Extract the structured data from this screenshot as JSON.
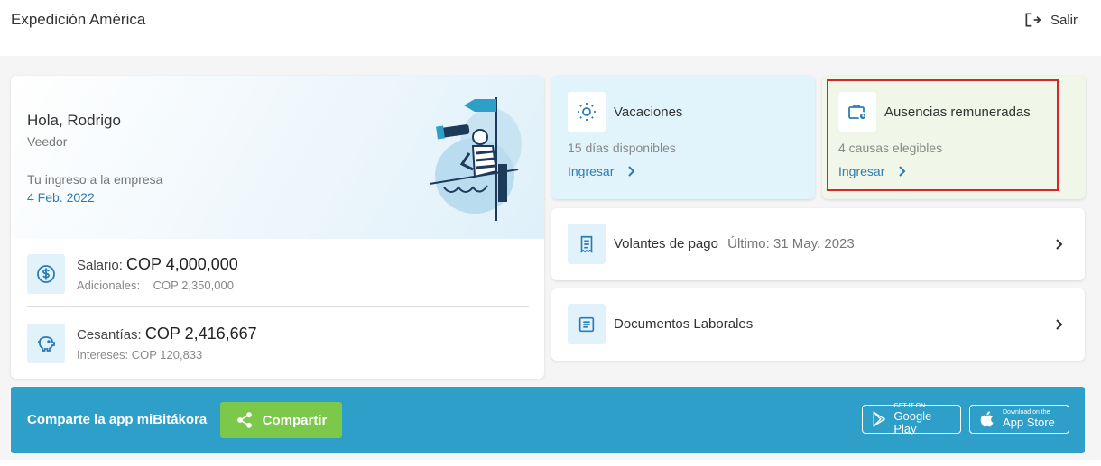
{
  "header": {
    "title": "Expedición América",
    "logout_label": "Salir"
  },
  "profile": {
    "greeting": "Hola, Rodrigo",
    "role": "Veedor",
    "join_label": "Tu ingreso a la empresa",
    "join_date": "4 Feb. 2022",
    "salary": {
      "label": "Salario:",
      "amount": "COP 4,000,000",
      "extra_label": "Adicionales:",
      "extra_value": "COP 2,350,000"
    },
    "cesantias": {
      "label": "Cesantías:",
      "amount": "COP 2,416,667",
      "extra_label": "Intereses:",
      "extra_value": "COP 120,833"
    }
  },
  "vacaciones": {
    "title": "Vacaciones",
    "subtitle": "15 días disponibles",
    "link": "Ingresar"
  },
  "ausencias": {
    "title": "Ausencias remuneradas",
    "subtitle": "4 causas elegibles",
    "link": "Ingresar"
  },
  "volantes": {
    "title": "Volantes de pago",
    "detail": "Último: 31 May. 2023"
  },
  "documentos": {
    "title": "Documentos Laborales"
  },
  "share": {
    "text": "Comparte la app miBitákora",
    "button": "Compartir",
    "google_small": "GET IT ON",
    "google_big": "Google Play",
    "apple_small": "Download on the",
    "apple_big": "App Store"
  },
  "colors": {
    "accent": "#2a7cb5",
    "banner": "#2e9fc8",
    "share_button": "#7cc84a",
    "highlight": "#d6262a"
  }
}
